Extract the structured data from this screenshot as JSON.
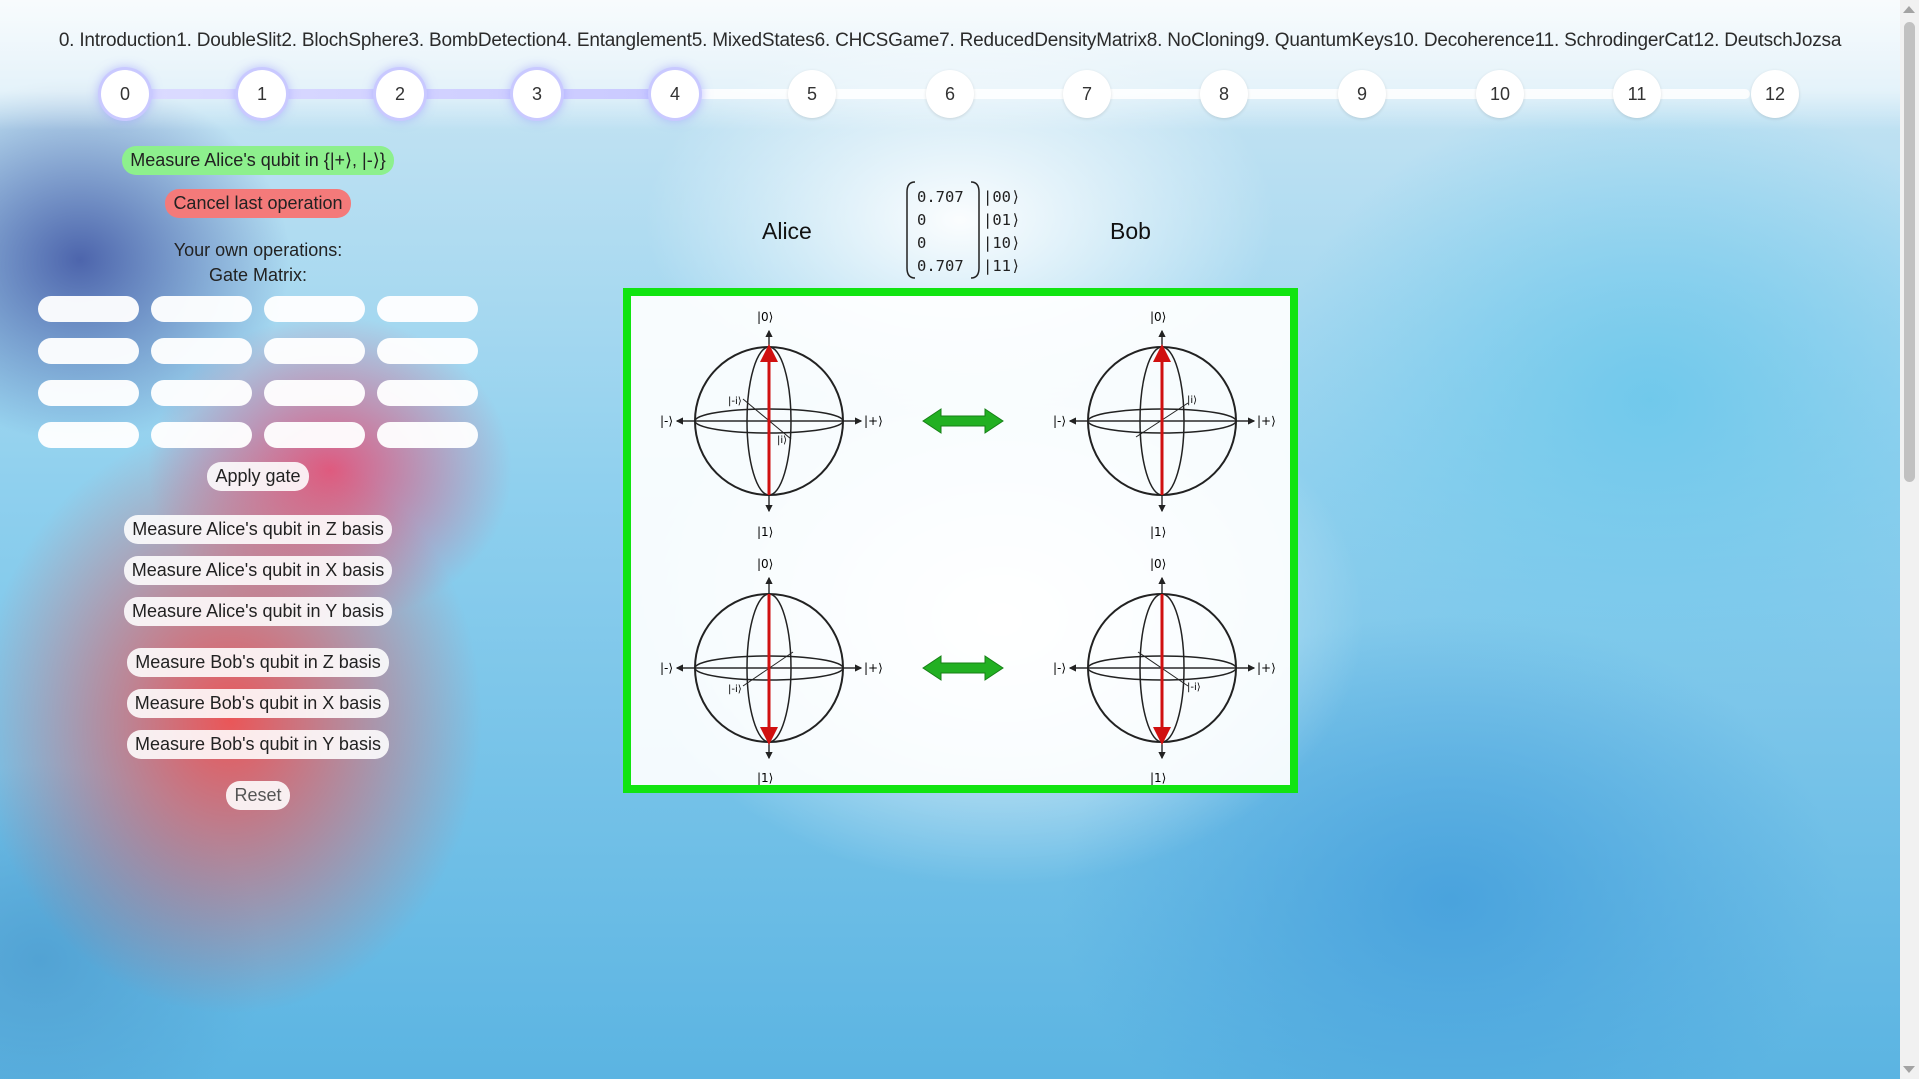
{
  "nav": {
    "tutorials": [
      "0. Introduction",
      "1. DoubleSlit",
      "2. BlochSphere",
      "3. BombDetection",
      "4. Entanglement",
      "5. MixedStates",
      "6. CHCSGame",
      "7. ReducedDensityMatrix",
      "8. NoCloning",
      "9. QuantumKeys",
      "10. Decoherence",
      "11. SchrodingerCat",
      "12. DeutschJozsa"
    ],
    "steps": [
      "0",
      "1",
      "2",
      "3",
      "4",
      "5",
      "6",
      "7",
      "8",
      "9",
      "10",
      "11",
      "12"
    ],
    "current_step": 4
  },
  "sidebar": {
    "measure_plusminus": "Measure Alice's qubit in {|+⟩, |-⟩}",
    "cancel": "Cancel last operation",
    "own_ops": "Your own operations:",
    "gate_matrix": "Gate Matrix:",
    "apply": "Apply gate",
    "alice_z": "Measure Alice's qubit in Z basis",
    "alice_x": "Measure Alice's qubit in X basis",
    "alice_y": "Measure Alice's qubit in Y basis",
    "bob_z": "Measure Bob's qubit in Z basis",
    "bob_x": "Measure Bob's qubit in X basis",
    "bob_y": "Measure Bob's qubit in Y basis",
    "reset": "Reset"
  },
  "main": {
    "alice": "Alice",
    "bob": "Bob",
    "state": [
      {
        "amp": "0.707",
        "ket": "|00⟩"
      },
      {
        "amp": "0",
        "ket": "|01⟩"
      },
      {
        "amp": "0",
        "ket": "|10⟩"
      },
      {
        "amp": "0.707",
        "ket": "|11⟩"
      }
    ],
    "bloch_labels": {
      "zero_a": "|0⟩",
      "zero_b": "|0⟩",
      "one_a": "|1⟩",
      "one_b": "|1⟩",
      "plus": "|+⟩",
      "minus": "|-⟩",
      "i_small": "|i⟩",
      "minus_i": "|-i⟩"
    }
  },
  "colors": {
    "panel_border": "#11e411",
    "arrow": "#22b022",
    "vector": "#d01010",
    "done_step_glow": "#c9c9ff"
  }
}
